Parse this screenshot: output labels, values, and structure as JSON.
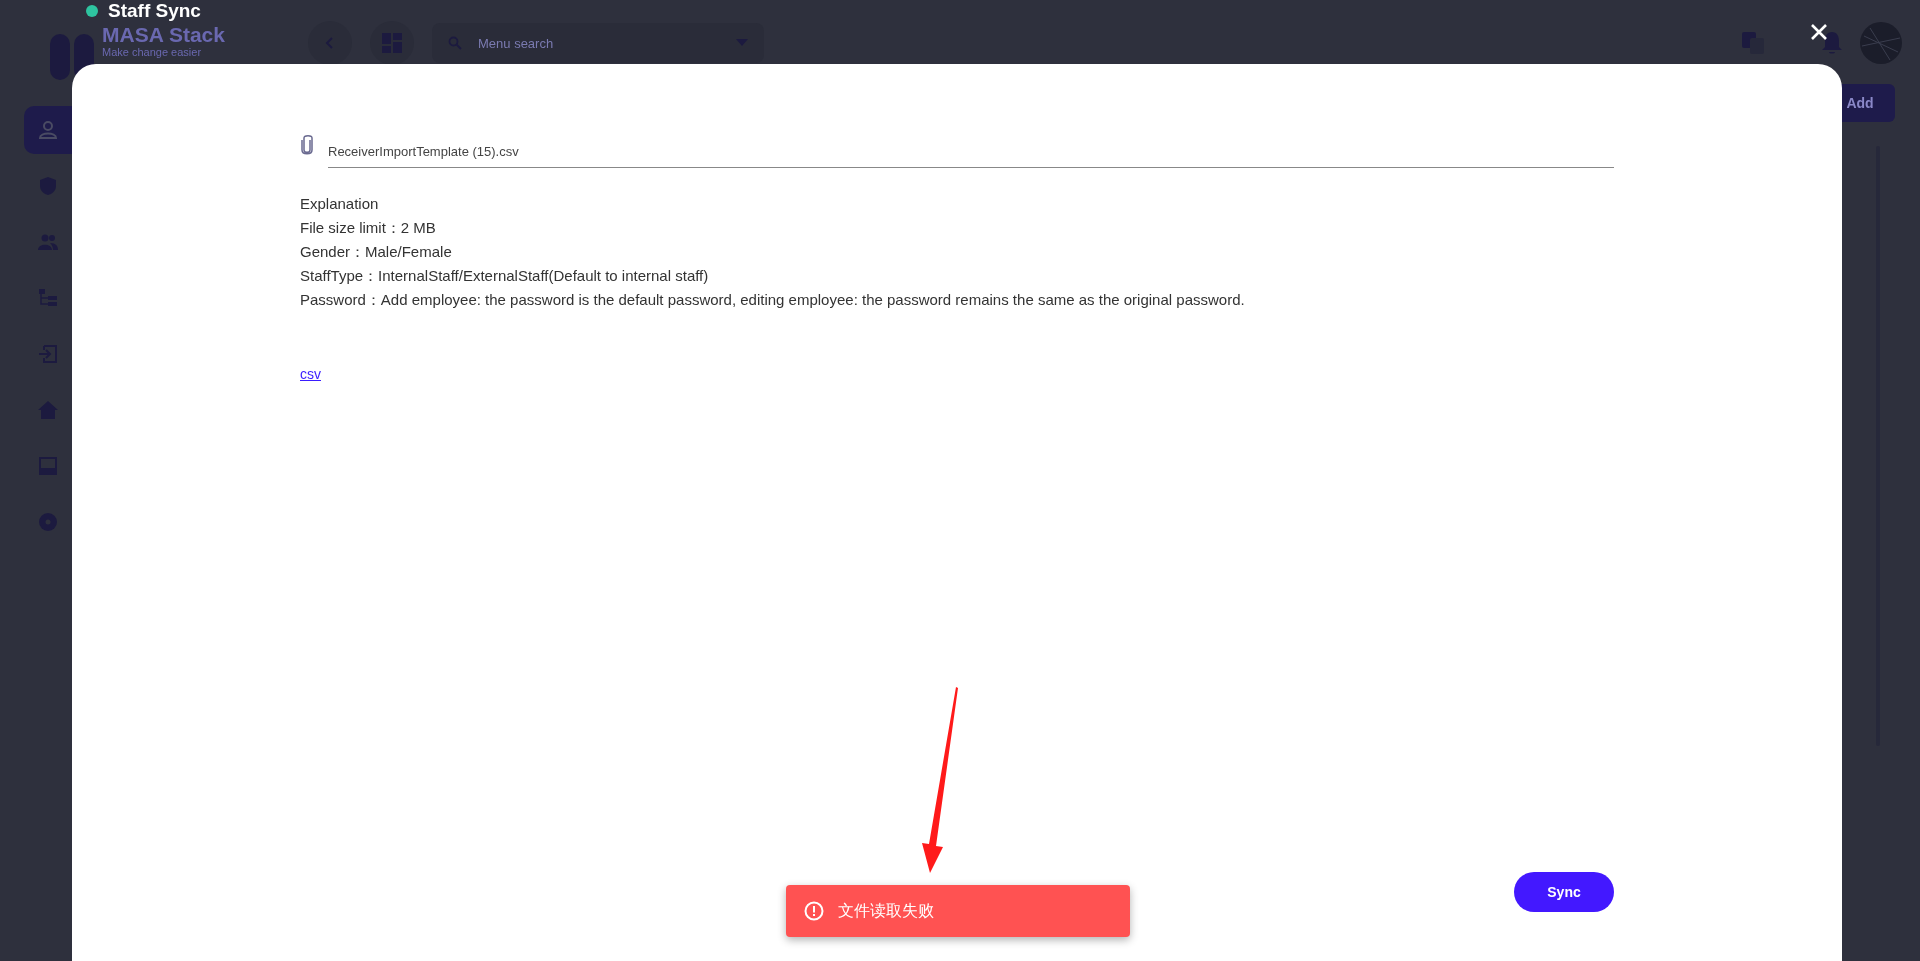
{
  "app": {
    "logo_title": "MASA Stack",
    "logo_tagline": "Make change easier",
    "search": {
      "placeholder": "Menu search"
    },
    "add_button": "Add",
    "sidebar": [
      {
        "kind": "user",
        "selected": true
      },
      {
        "kind": "shield",
        "selected": false
      },
      {
        "kind": "people",
        "selected": false
      },
      {
        "kind": "tree",
        "selected": false
      },
      {
        "kind": "login",
        "selected": false
      },
      {
        "kind": "house",
        "selected": false
      },
      {
        "kind": "panel",
        "selected": false
      },
      {
        "kind": "disc",
        "selected": false
      }
    ]
  },
  "dialog": {
    "title": "Staff Sync",
    "file_field": {
      "value": "ReceiverImportTemplate (15).csv"
    },
    "explanation": [
      "Explanation",
      "File size limit：2 MB",
      "Gender：Male/Female",
      "StaffType：InternalStaff/ExternalStaff(Default to internal staff)",
      "Password：Add employee: the password is the default password, editing employee: the password remains the same as the original password."
    ],
    "link": "csv",
    "button": "Sync"
  },
  "toast": {
    "kind": "error",
    "message": "文件读取失败"
  }
}
